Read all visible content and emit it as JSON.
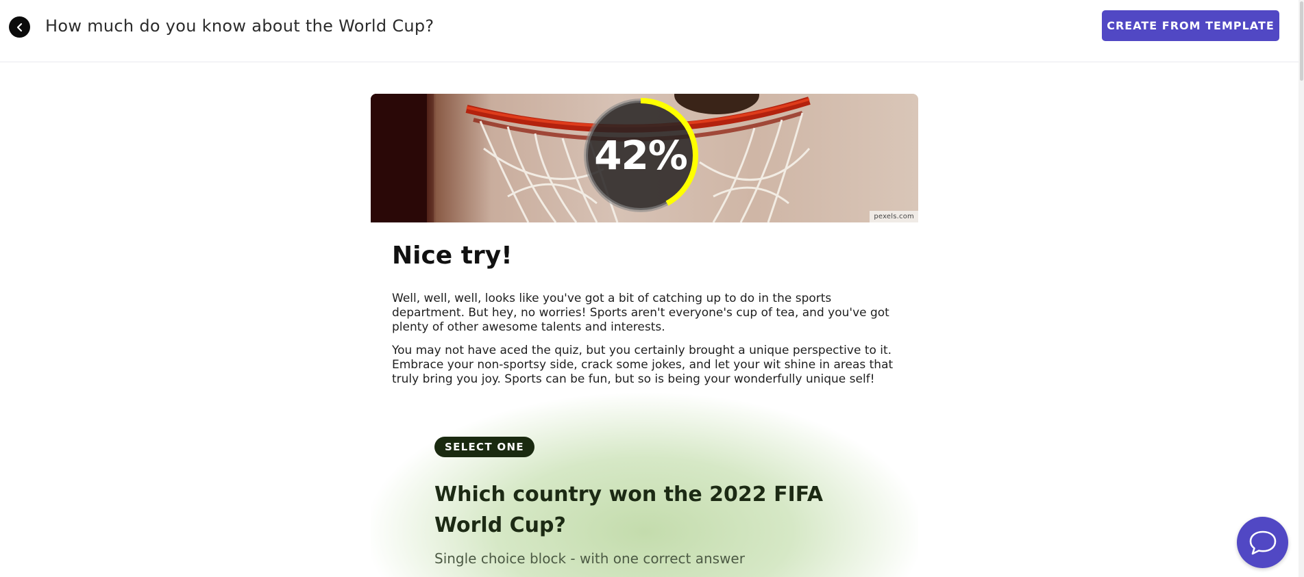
{
  "header": {
    "title": "How much do you know about the World Cup?",
    "create_button_label": "CREATE FROM TEMPLATE"
  },
  "result": {
    "score": 0.42,
    "score_label": "42%",
    "image_credit": "pexels.com",
    "title": "Nice try!",
    "paragraphs": [
      "Well, well, well, looks like you've got a bit of catching up to do in the sports department. But hey, no worries! Sports aren't everyone's cup of tea, and you've got plenty of other awesome talents and interests.",
      "You may not have aced the quiz, but you certainly brought a unique perspective to it. Embrace your non-sportsy side, crack some jokes, and let your wit shine in areas that truly bring you joy. Sports can be fun, but so is being your wonderfully unique self!"
    ]
  },
  "question": {
    "badge": "SELECT ONE",
    "text": "Which country won the 2022 FIFA World Cup?",
    "subtitle": "Single choice block - with one correct answer"
  },
  "colors": {
    "accent": "#5148c4",
    "score_ring": "#ffff00",
    "badge_bg": "#1a2a10",
    "question_tint": "#c4dcad"
  },
  "icons": {
    "back": "chevron-left-icon",
    "chat": "chat-bubble-icon"
  }
}
